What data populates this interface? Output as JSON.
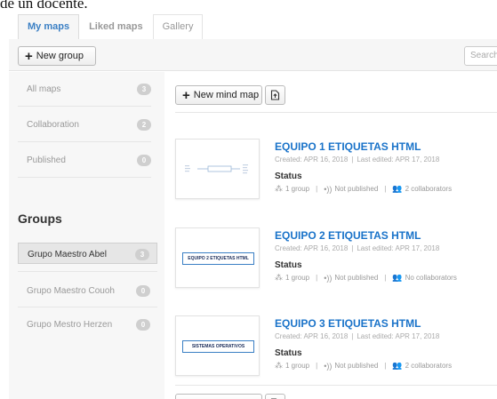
{
  "top_caption": "de un docente.",
  "tabs": [
    "My maps",
    "Liked maps",
    "Gallery"
  ],
  "toolbar": {
    "new_group_label": "New group",
    "search_placeholder": "Search"
  },
  "sidebar": {
    "items": [
      {
        "label": "All maps",
        "count": "3"
      },
      {
        "label": "Collaboration",
        "count": "2"
      },
      {
        "label": "Published",
        "count": "0"
      }
    ],
    "groups_heading": "Groups",
    "groups": [
      {
        "label": "Grupo Maestro Abel",
        "count": "3",
        "active": true
      },
      {
        "label": "Grupo Maestro Couoh",
        "count": "0",
        "active": false
      },
      {
        "label": "Grupo Mestro Herzen",
        "count": "0",
        "active": false
      }
    ]
  },
  "main": {
    "new_map_label": "New mind map",
    "status_heading": "Status",
    "maps": [
      {
        "title": "EQUIPO 1 ETIQUETAS HTML",
        "created": "Created: APR 16, 2018",
        "edited": "Last edited: APR 17, 2018",
        "groups": "1 group",
        "published": "Not published",
        "collaborators": "2 collaborators",
        "thumb_text": ""
      },
      {
        "title": "EQUIPO 2 ETIQUETAS HTML",
        "created": "Created: APR 16, 2018",
        "edited": "Last edited: APR 17, 2018",
        "groups": "1 group",
        "published": "Not published",
        "collaborators": "No collaborators",
        "thumb_text": "EQUIPO 2 ETIQUETAS HTML"
      },
      {
        "title": "EQUIPO 3 ETIQUETAS HTML",
        "created": "Created: APR 16, 2018",
        "edited": "Last edited: APR 17, 2018",
        "groups": "1 group",
        "published": "Not published",
        "collaborators": "2 collaborators",
        "thumb_text": "SISTEMAS OPERATIVOS"
      }
    ]
  },
  "colors": {
    "accent": "#1a73c9",
    "tab_active": "#3a7fc4",
    "badge": "#cfcfcf"
  },
  "icons": {
    "new": "plus-icon",
    "import": "import-icon",
    "groups": "group-icon",
    "publish": "broadcast-icon",
    "collaborators": "people-icon"
  }
}
